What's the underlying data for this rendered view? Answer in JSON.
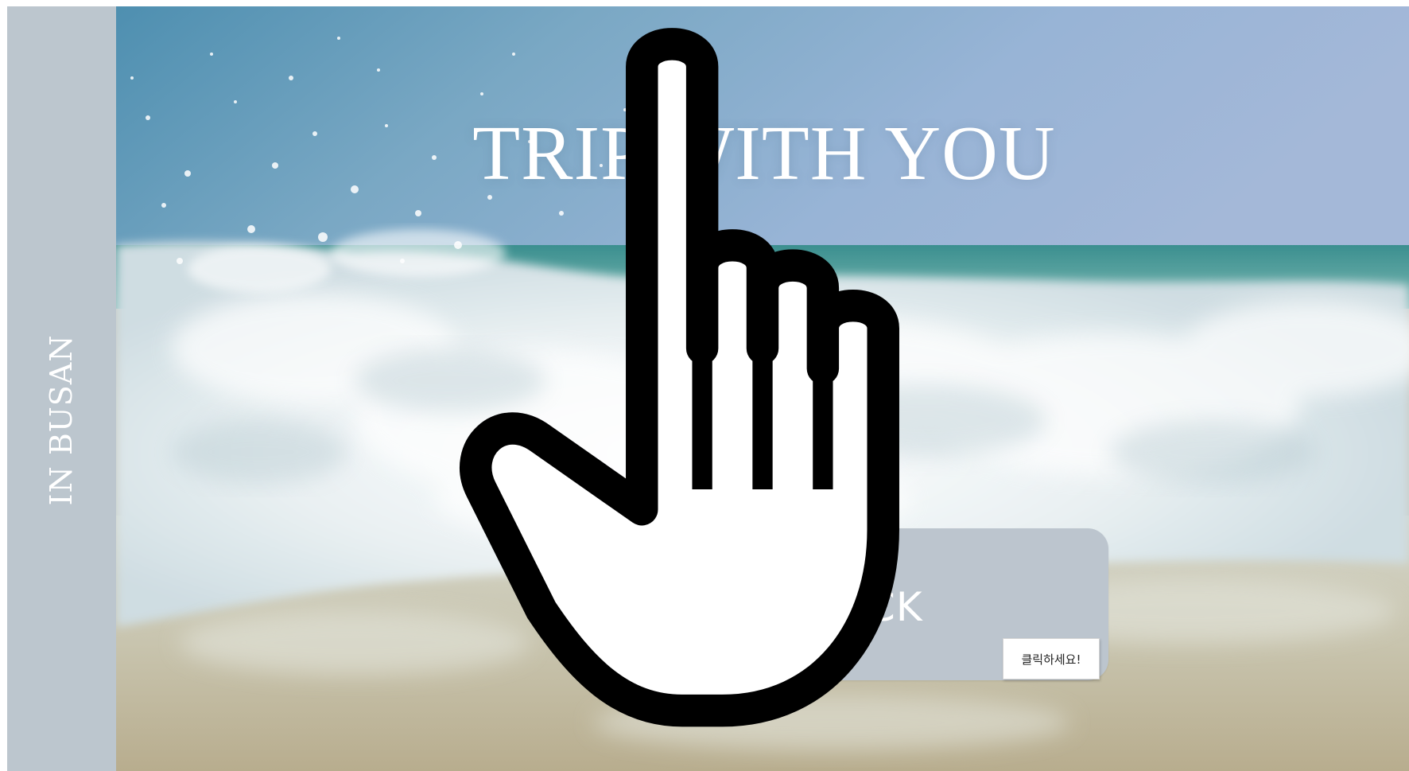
{
  "sidebar": {
    "label": "IN BUSAN",
    "background_color": "#bcc6ce"
  },
  "hero": {
    "title": "TRIP WITH YOU",
    "background_scene": "ocean-wave-splash"
  },
  "cta": {
    "label": "CLICK",
    "background_color": "#bcc5ce",
    "tooltip": "클릭하세요!"
  },
  "icons": {
    "cursor": "hand-pointer-icon"
  }
}
